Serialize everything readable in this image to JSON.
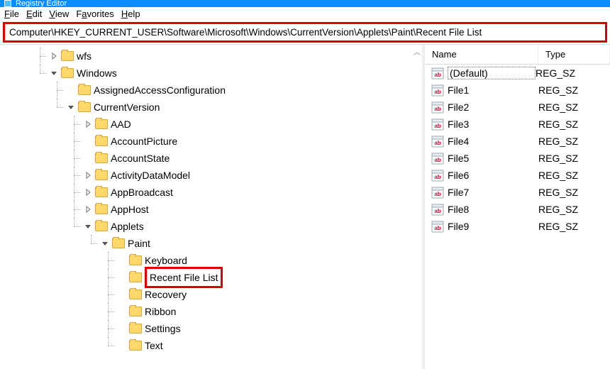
{
  "title": "Registry Editor",
  "menu": {
    "file": "File",
    "edit": "Edit",
    "view": "View",
    "favorites": "Favorites",
    "help": "Help"
  },
  "address": "Computer\\HKEY_CURRENT_USER\\Software\\Microsoft\\Windows\\CurrentVersion\\Applets\\Paint\\Recent File List",
  "list": {
    "headers": {
      "name": "Name",
      "type": "Type"
    },
    "items": [
      {
        "name": "(Default)",
        "type": "REG_SZ",
        "default": true
      },
      {
        "name": "File1",
        "type": "REG_SZ"
      },
      {
        "name": "File2",
        "type": "REG_SZ"
      },
      {
        "name": "File3",
        "type": "REG_SZ"
      },
      {
        "name": "File4",
        "type": "REG_SZ"
      },
      {
        "name": "File5",
        "type": "REG_SZ"
      },
      {
        "name": "File6",
        "type": "REG_SZ"
      },
      {
        "name": "File7",
        "type": "REG_SZ"
      },
      {
        "name": "File8",
        "type": "REG_SZ"
      },
      {
        "name": "File9",
        "type": "REG_SZ"
      }
    ]
  },
  "tree": [
    {
      "label": "wfs",
      "toggle": "closed",
      "depth": 0
    },
    {
      "label": "Windows",
      "toggle": "open",
      "depth": 0,
      "children": [
        {
          "label": "AssignedAccessConfiguration",
          "toggle": "none",
          "depth": 1
        },
        {
          "label": "CurrentVersion",
          "toggle": "open",
          "depth": 1,
          "children": [
            {
              "label": "AAD",
              "toggle": "closed",
              "depth": 2
            },
            {
              "label": "AccountPicture",
              "toggle": "none",
              "depth": 2
            },
            {
              "label": "AccountState",
              "toggle": "none",
              "depth": 2
            },
            {
              "label": "ActivityDataModel",
              "toggle": "closed",
              "depth": 2
            },
            {
              "label": "AppBroadcast",
              "toggle": "closed",
              "depth": 2
            },
            {
              "label": "AppHost",
              "toggle": "closed",
              "depth": 2
            },
            {
              "label": "Applets",
              "toggle": "open",
              "depth": 2,
              "children": [
                {
                  "label": "Paint",
                  "toggle": "open",
                  "depth": 3,
                  "children": [
                    {
                      "label": "Keyboard",
                      "toggle": "none",
                      "depth": 4
                    },
                    {
                      "label": "Recent File List",
                      "toggle": "none",
                      "depth": 4,
                      "selected": true
                    },
                    {
                      "label": "Recovery",
                      "toggle": "none",
                      "depth": 4
                    },
                    {
                      "label": "Ribbon",
                      "toggle": "none",
                      "depth": 4
                    },
                    {
                      "label": "Settings",
                      "toggle": "none",
                      "depth": 4
                    },
                    {
                      "label": "Text",
                      "toggle": "none",
                      "depth": 4
                    }
                  ]
                }
              ]
            }
          ]
        }
      ]
    }
  ]
}
